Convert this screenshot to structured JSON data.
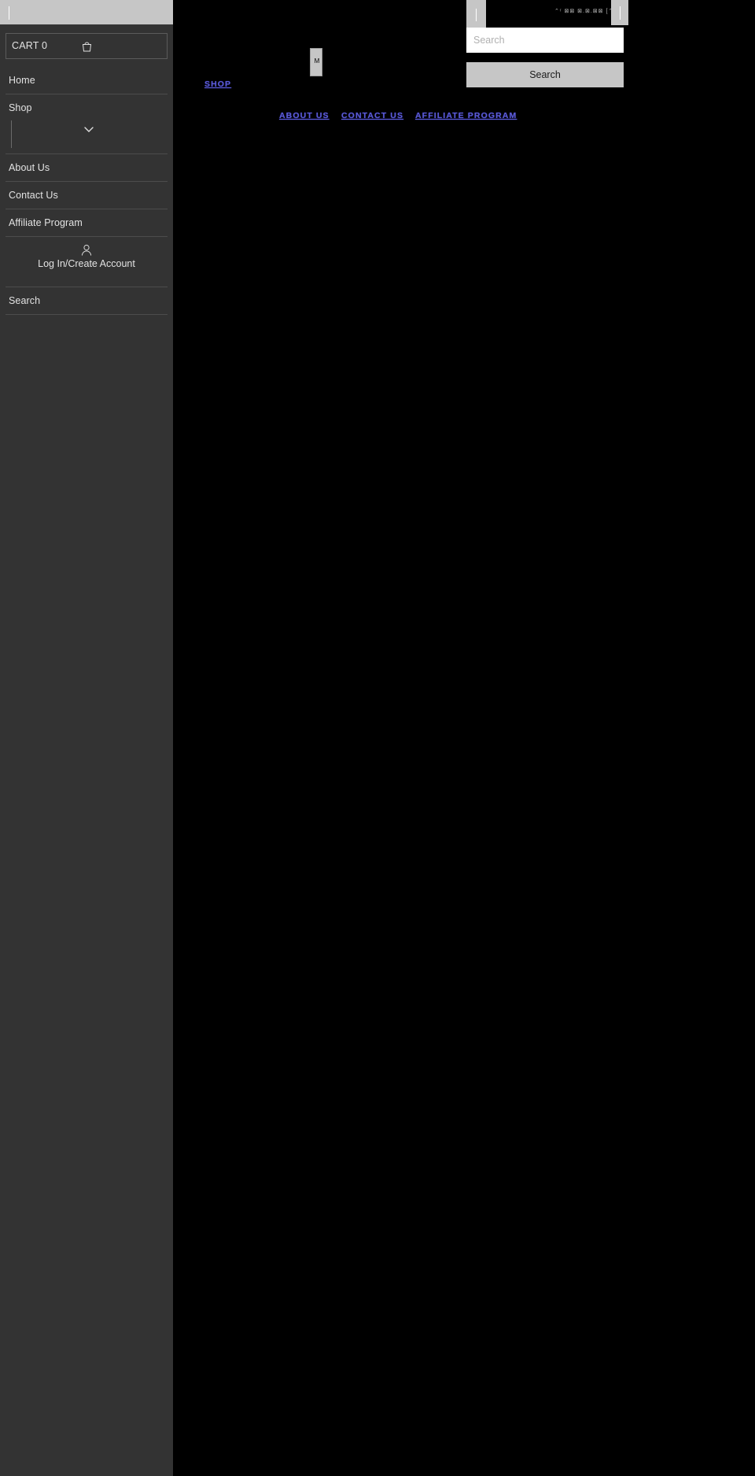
{
  "sidebar": {
    "topbar": {
      "caret": "text-cursor"
    },
    "cart": {
      "label": "CART 0",
      "icon": "shopping-bag-icon"
    },
    "items": [
      {
        "label": "Home",
        "type": "link"
      },
      {
        "label": "Shop",
        "type": "expandable",
        "icon": "chevron-down-icon"
      },
      {
        "label": "About Us",
        "type": "link"
      },
      {
        "label": "Contact Us",
        "type": "link"
      },
      {
        "label": "Affiliate Program",
        "type": "link"
      },
      {
        "label": "Log In/Create Account",
        "type": "account",
        "icon": "user-icon"
      },
      {
        "label": "Search",
        "type": "link"
      }
    ]
  },
  "page": {
    "mini_box": {
      "text": "M"
    },
    "links": [
      {
        "label": "SHOP"
      },
      {
        "label": "ABOUT US"
      },
      {
        "label": "CONTACT US"
      },
      {
        "label": "AFFILIATE PROGRAM"
      }
    ]
  },
  "search_overlay": {
    "garbled_text": "⌃ʳ ⊠⊠ ⊠.⊠.⊠⊠ [⌃⊠ ] ⊠",
    "input": {
      "placeholder": "Search",
      "value": ""
    },
    "button_label": "Search"
  },
  "colors": {
    "sidebar_bg": "#333333",
    "page_bg": "#000000",
    "chrome_gray": "#c6c6c6",
    "link_blue": "#5b5bd6",
    "text_light": "#e3e3e3"
  }
}
